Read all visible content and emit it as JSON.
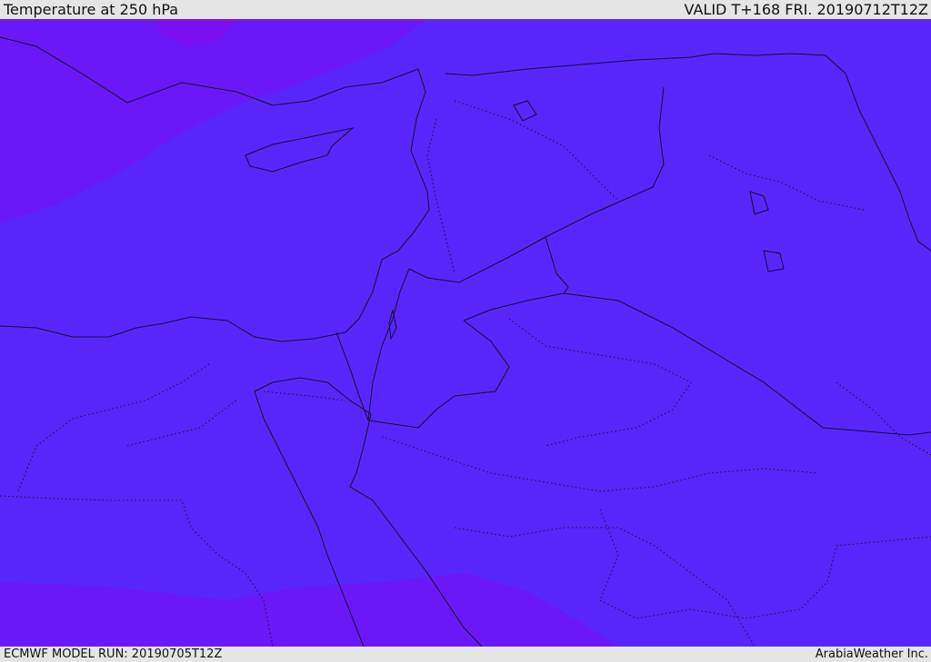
{
  "header": {
    "title": "Temperature at 250 hPa",
    "valid_time": "VALID T+168 FRI. 20190712T12Z"
  },
  "footer": {
    "model_run": "ECMWF MODEL RUN: 20190705T12Z",
    "credit": "ArabiaWeather Inc."
  },
  "map": {
    "colors": {
      "field_main": "#5826fb",
      "field_cold_band": "#6a18f8",
      "field_cold_core": "#7a10f2",
      "coastline": "#101030",
      "border": "#101030"
    }
  }
}
